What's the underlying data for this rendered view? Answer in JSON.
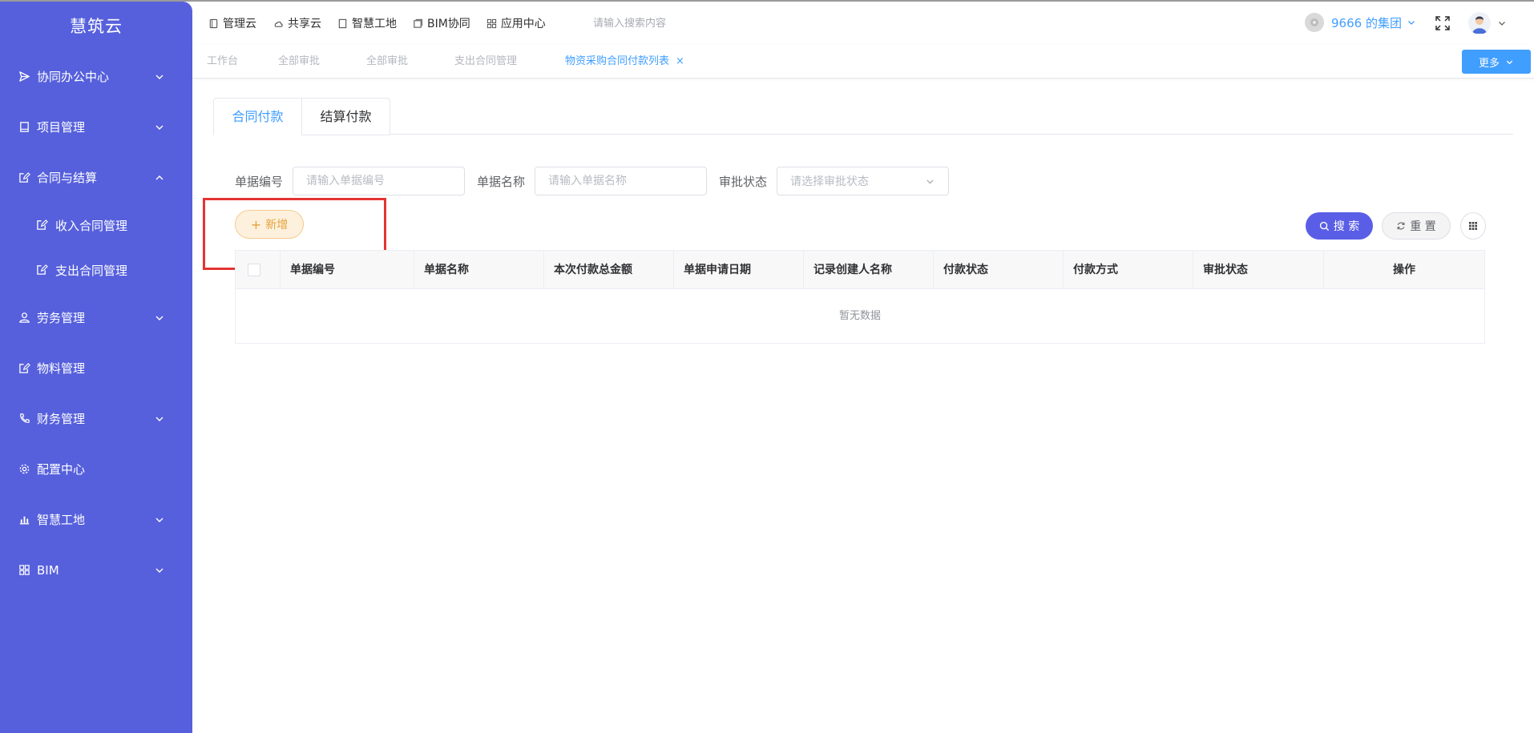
{
  "app": {
    "title": "慧筑云"
  },
  "sidebar": {
    "items": [
      {
        "label": "协同办公中心",
        "icon": "send-icon",
        "expandable": true,
        "expanded": false
      },
      {
        "label": "项目管理",
        "icon": "book-icon",
        "expandable": true,
        "expanded": false
      },
      {
        "label": "合同与结算",
        "icon": "edit-icon",
        "expandable": true,
        "expanded": true
      },
      {
        "label": "劳务管理",
        "icon": "user-icon",
        "expandable": true,
        "expanded": false
      },
      {
        "label": "物料管理",
        "icon": "edit-icon",
        "expandable": false
      },
      {
        "label": "财务管理",
        "icon": "phone-icon",
        "expandable": true,
        "expanded": false
      },
      {
        "label": "配置中心",
        "icon": "gear-icon",
        "expandable": false
      },
      {
        "label": "智慧工地",
        "icon": "bar-chart-icon",
        "expandable": true,
        "expanded": false
      },
      {
        "label": "BIM",
        "icon": "grid-icon",
        "expandable": true,
        "expanded": false
      }
    ],
    "sub_items": [
      {
        "label": "收入合同管理",
        "icon": "edit-icon"
      },
      {
        "label": "支出合同管理",
        "icon": "edit-icon"
      }
    ]
  },
  "header": {
    "nav": [
      {
        "label": "管理云",
        "icon": "notebook-icon"
      },
      {
        "label": "共享云",
        "icon": "cloud-icon"
      },
      {
        "label": "智慧工地",
        "icon": "document-icon"
      },
      {
        "label": "BIM协同",
        "icon": "cube-icon"
      },
      {
        "label": "应用中心",
        "icon": "apps-icon"
      }
    ],
    "search_placeholder": "请输入搜索内容",
    "group_name": "9666 的集团"
  },
  "tags": {
    "items": [
      {
        "label": "工作台",
        "active": false
      },
      {
        "label": "全部审批",
        "active": false
      },
      {
        "label": "全部审批",
        "active": false
      },
      {
        "label": "支出合同管理",
        "active": false
      },
      {
        "label": "物资采购合同付款列表",
        "active": true,
        "close": "×"
      }
    ],
    "more_label": "更多"
  },
  "tabs": [
    {
      "label": "合同付款",
      "active": true
    },
    {
      "label": "结算付款",
      "active": false
    }
  ],
  "filters": {
    "code_label": "单据编号",
    "code_placeholder": "请输入单据编号",
    "name_label": "单据名称",
    "name_placeholder": "请输入单据名称",
    "status_label": "审批状态",
    "status_placeholder": "请选择审批状态"
  },
  "actions": {
    "add_label": "新增",
    "add_symbol": "+",
    "search_label": "搜 索",
    "reset_label": "重 置"
  },
  "table": {
    "columns": [
      "单据编号",
      "单据名称",
      "本次付款总金额",
      "单据申请日期",
      "记录创建人名称",
      "付款状态",
      "付款方式",
      "审批状态",
      "操作"
    ],
    "empty_text": "暂无数据"
  },
  "colors": {
    "sidebar_bg": "#5660dc",
    "primary": "#409eff",
    "search_btn": "#5a5ee6",
    "add_btn_text": "#e6a23c",
    "highlight": "#e53333"
  }
}
